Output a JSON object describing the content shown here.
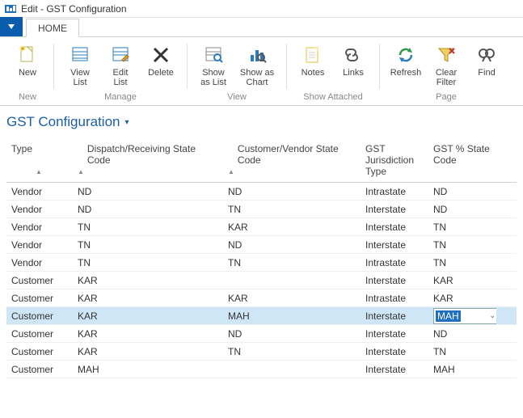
{
  "window": {
    "title": "Edit - GST Configuration"
  },
  "tabs": {
    "home": "HOME"
  },
  "ribbon": {
    "new": "New",
    "view_list": "View\nList",
    "edit_list": "Edit\nList",
    "delete": "Delete",
    "show_as_list": "Show\nas List",
    "show_as_chart": "Show as\nChart",
    "notes": "Notes",
    "links": "Links",
    "refresh": "Refresh",
    "clear_filter": "Clear\nFilter",
    "find": "Find",
    "groups": {
      "new": "New",
      "manage": "Manage",
      "view": "View",
      "show_attached": "Show Attached",
      "page": "Page"
    }
  },
  "page": {
    "title": "GST Configuration"
  },
  "columns": {
    "type": "Type",
    "dispatch": "Dispatch/Receiving State Code",
    "custvend": "Customer/Vendor State Code",
    "jurisdiction": "GST Jurisdiction Type",
    "gstpct": "GST % State Code"
  },
  "rows": [
    {
      "type": "Vendor",
      "dispatch": "ND",
      "custvend": "ND",
      "jur": "Intrastate",
      "gst": "ND"
    },
    {
      "type": "Vendor",
      "dispatch": "ND",
      "custvend": "TN",
      "jur": "Interstate",
      "gst": "ND"
    },
    {
      "type": "Vendor",
      "dispatch": "TN",
      "custvend": "KAR",
      "jur": "Interstate",
      "gst": "TN"
    },
    {
      "type": "Vendor",
      "dispatch": "TN",
      "custvend": "ND",
      "jur": "Interstate",
      "gst": "TN"
    },
    {
      "type": "Vendor",
      "dispatch": "TN",
      "custvend": "TN",
      "jur": "Intrastate",
      "gst": "TN"
    },
    {
      "type": "Customer",
      "dispatch": "KAR",
      "custvend": "",
      "jur": "Interstate",
      "gst": "KAR"
    },
    {
      "type": "Customer",
      "dispatch": "KAR",
      "custvend": "KAR",
      "jur": "Intrastate",
      "gst": "KAR"
    },
    {
      "type": "Customer",
      "dispatch": "KAR",
      "custvend": "MAH",
      "jur": "Interstate",
      "gst": "MAH",
      "selected": true,
      "editing": true
    },
    {
      "type": "Customer",
      "dispatch": "KAR",
      "custvend": "ND",
      "jur": "Interstate",
      "gst": "ND"
    },
    {
      "type": "Customer",
      "dispatch": "KAR",
      "custvend": "TN",
      "jur": "Interstate",
      "gst": "TN"
    },
    {
      "type": "Customer",
      "dispatch": "MAH",
      "custvend": "",
      "jur": "Interstate",
      "gst": "MAH"
    }
  ]
}
